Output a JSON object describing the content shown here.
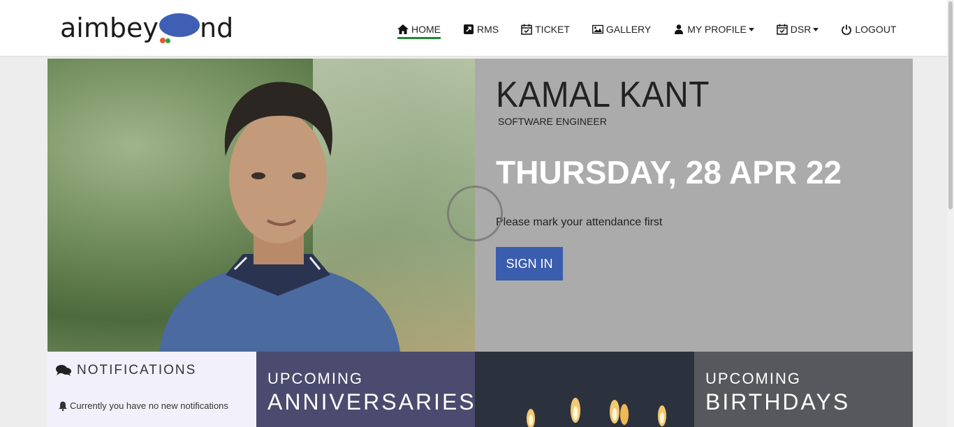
{
  "header": {
    "logo_left": "aimbey",
    "logo_right": "nd",
    "nav": [
      {
        "label": "HOME",
        "icon": "home-icon",
        "active": true
      },
      {
        "label": "RMS",
        "icon": "external-link-icon"
      },
      {
        "label": "TICKET",
        "icon": "calendar-check-icon"
      },
      {
        "label": "GALLERY",
        "icon": "image-icon"
      },
      {
        "label": "MY PROFILE",
        "icon": "user-icon",
        "dropdown": true
      },
      {
        "label": "DSR",
        "icon": "calendar-check-icon",
        "dropdown": true
      },
      {
        "label": "LOGOUT",
        "icon": "power-icon"
      }
    ]
  },
  "hero": {
    "name": "KAMAL KANT",
    "role": "SOFTWARE ENGINEER",
    "date": "THURSDAY, 28 APR 22",
    "note": "Please mark your attendance first",
    "signin_label": "SIGN IN"
  },
  "notifications": {
    "title": "NOTIFICATIONS",
    "message": "Currently you have no new notifications"
  },
  "anniversaries": {
    "small": "UPCOMING",
    "big": "ANNIVERSARIES"
  },
  "birthdays": {
    "small": "UPCOMING",
    "big": "BIRTHDAYS"
  },
  "colors": {
    "accent": "#3a5dae",
    "active_underline": "#1e8a2e",
    "info_panel": "#ababab"
  }
}
